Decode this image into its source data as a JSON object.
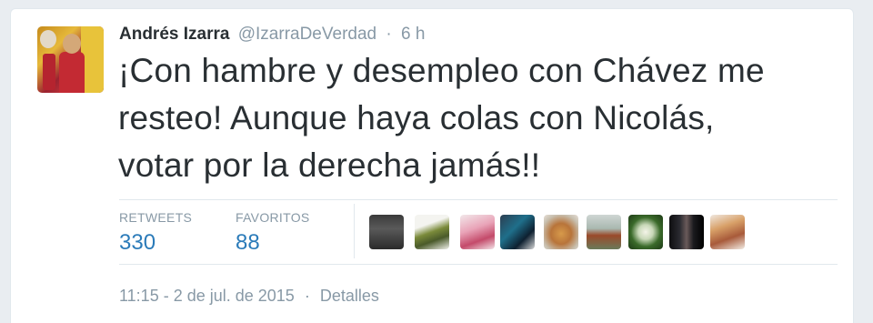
{
  "tweet": {
    "author_name": "Andrés Izarra",
    "author_handle": "@IzarraDeVerdad",
    "separator": "·",
    "time_ago": "6 h",
    "text_lines": [
      "¡Con hambre y desempleo con Chávez me",
      "resteo! Aunque haya colas con Nicolás,",
      "votar por la derecha jamás!!"
    ]
  },
  "stats": {
    "retweets_label": "RETWEETS",
    "retweets_value": "330",
    "favorites_label": "FAVORITOS",
    "favorites_value": "88"
  },
  "favoriters": [
    {
      "icon": "user-avatar-1"
    },
    {
      "icon": "user-avatar-2"
    },
    {
      "icon": "user-avatar-3"
    },
    {
      "icon": "user-avatar-4"
    },
    {
      "icon": "user-avatar-5"
    },
    {
      "icon": "user-avatar-6"
    },
    {
      "icon": "user-avatar-7"
    },
    {
      "icon": "user-avatar-8"
    },
    {
      "icon": "user-avatar-9"
    }
  ],
  "footer": {
    "timestamp": "11:15 - 2 de jul. de 2015",
    "separator": "·",
    "details_link": "Detalles"
  },
  "colors": {
    "link_blue": "#2b7bb9",
    "muted_gray": "#8899a6",
    "text_dark": "#292f33",
    "page_bg": "#e9edf1"
  }
}
